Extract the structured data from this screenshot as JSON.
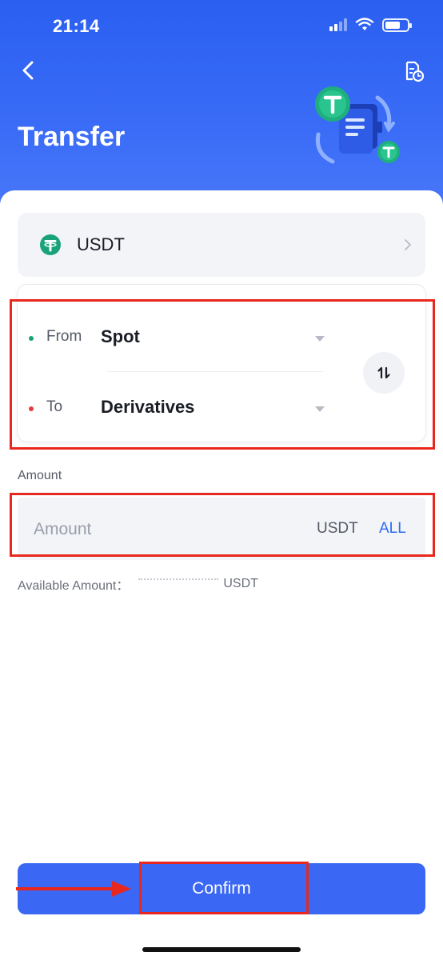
{
  "status_bar": {
    "time": "21:14"
  },
  "header": {
    "title": "Transfer"
  },
  "coin": {
    "symbol": "USDT",
    "icon": "tether-icon",
    "icon_color": "#1aa37a"
  },
  "transfer": {
    "from_label": "From",
    "from_value": "Spot",
    "to_label": "To",
    "to_value": "Derivatives",
    "from_dot_color": "#1aa37a",
    "to_dot_color": "#e23b3b",
    "swap_icon": "swap-arrows-icon"
  },
  "amount": {
    "title": "Amount",
    "placeholder": "Amount",
    "unit": "USDT",
    "all_label": "ALL"
  },
  "available": {
    "label": "Available Amount：",
    "unit": "USDT"
  },
  "confirm_label": "Confirm",
  "colors": {
    "primary": "#3a67f3",
    "header": "#2b5ff0",
    "annotation": "#e8281e"
  }
}
